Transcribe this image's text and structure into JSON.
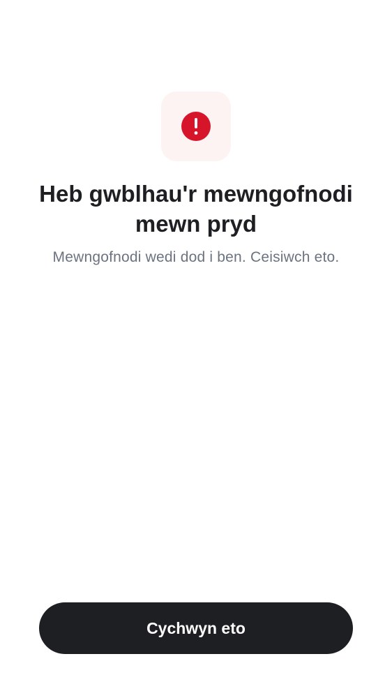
{
  "error_icon": {
    "icon": "exclamation-circle-icon",
    "accent_color": "#d7152a",
    "tile_color": "#fdf3f3"
  },
  "title": "Heb gwblhau'r mewngofnodi mewn pryd",
  "subtitle": "Mewngofnodi wedi dod i ben. Ceisiwch eto.",
  "actions": {
    "retry_label": "Cychwyn eto"
  }
}
